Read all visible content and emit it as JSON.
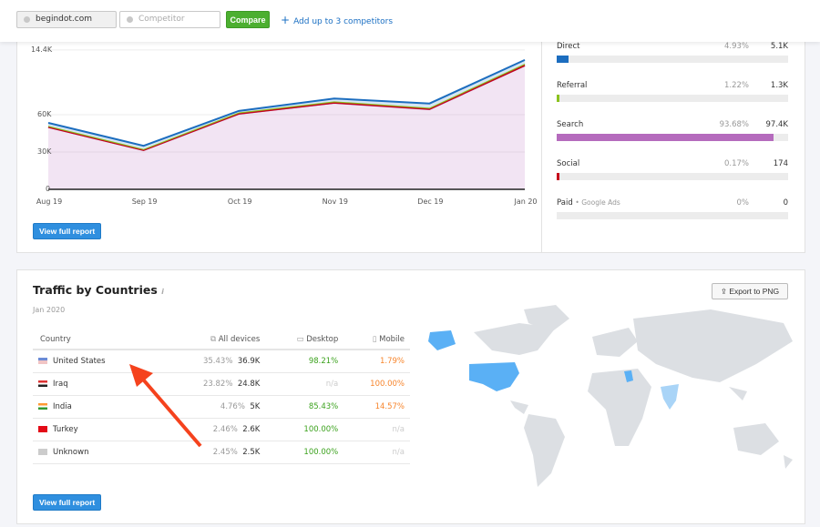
{
  "topbar": {
    "domain_value": "begindot.com",
    "competitor_placeholder": "Competitor",
    "compare_label": "Compare",
    "add_label": "Add up to 3 competitors"
  },
  "chart_data": {
    "type": "area",
    "stacked": true,
    "categories": [
      "Aug 19",
      "Sep 19",
      "Oct 19",
      "Nov 19",
      "Dec 19",
      "Jan 20"
    ],
    "yticks": [
      "0",
      "30K",
      "60K",
      "14.4K"
    ],
    "ylim": [
      0,
      112000
    ],
    "grid": true,
    "series": [
      {
        "key": "search",
        "color": "#b56bbd",
        "values": [
          50000,
          31500,
          60700,
          69500,
          64400,
          99500
        ]
      },
      {
        "key": "social",
        "color": "#c6001b",
        "values": [
          100,
          80,
          150,
          120,
          200,
          174
        ]
      },
      {
        "key": "referral",
        "color": "#8bc21f",
        "values": [
          900,
          800,
          1000,
          1100,
          1000,
          1300
        ]
      },
      {
        "key": "direct",
        "color": "#1c6dbf",
        "values": [
          2400,
          2600,
          1200,
          2300,
          3400,
          3000
        ]
      }
    ]
  },
  "traffic_panel": {
    "view_full_report": "View full report"
  },
  "sources": [
    {
      "label": "Direct",
      "pct": "4.93%",
      "value": "5.1K",
      "share": 4.93,
      "color": "#1c6dbf"
    },
    {
      "label": "Referral",
      "pct": "1.22%",
      "value": "1.3K",
      "share": 1.22,
      "color": "#8bc21f"
    },
    {
      "label": "Search",
      "pct": "93.68%",
      "value": "97.4K",
      "share": 93.68,
      "color": "#b56bbd"
    },
    {
      "label": "Social",
      "pct": "0.17%",
      "value": "174",
      "share": 0.17,
      "color": "#c6001b"
    },
    {
      "label": "Paid",
      "sub": "Google Ads",
      "pct": "0%",
      "value": "0",
      "share": 0,
      "color": "#999999"
    }
  ],
  "countries": {
    "title": "Traffic by Countries",
    "info": "i",
    "date": "Jan 2020",
    "export_label": "Export to PNG",
    "columns": [
      "Country",
      "All devices",
      "Desktop",
      "Mobile"
    ],
    "rows": [
      {
        "country": "United States",
        "share": "35.43%",
        "all": "36.9K",
        "desktop": "98.21%",
        "mobile": "1.79%"
      },
      {
        "country": "Iraq",
        "share": "23.82%",
        "all": "24.8K",
        "desktop": "n/a",
        "mobile": "100.00%"
      },
      {
        "country": "India",
        "share": "4.76%",
        "all": "5K",
        "desktop": "85.43%",
        "mobile": "14.57%"
      },
      {
        "country": "Turkey",
        "share": "2.46%",
        "all": "2.6K",
        "desktop": "100.00%",
        "mobile": "n/a"
      },
      {
        "country": "Unknown",
        "share": "2.45%",
        "all": "2.5K",
        "desktop": "100.00%",
        "mobile": "n/a"
      }
    ],
    "view_full_report": "View full report",
    "highlight_color": "#5ab0f5",
    "arrow_color": "#f5421d"
  }
}
